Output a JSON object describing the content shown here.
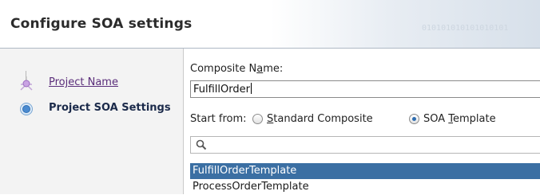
{
  "header": {
    "title": "Configure SOA settings",
    "binary": "010101010101010101"
  },
  "nav": {
    "items": [
      {
        "label": "Project Name",
        "state": "done",
        "icon": "completed-step-icon"
      },
      {
        "label": "Project SOA Settings",
        "state": "current",
        "icon": "current-step-icon"
      }
    ]
  },
  "form": {
    "composite_name": {
      "label_pre": "Composite N",
      "label_mnemonic": "a",
      "label_post": "me:",
      "value": "FulfillOrder"
    },
    "start_from": {
      "label": "Start from:",
      "options": [
        {
          "pre": "",
          "mnemonic": "S",
          "post": "tandard Composite",
          "selected": false
        },
        {
          "pre": "SOA ",
          "mnemonic": "T",
          "post": "emplate",
          "selected": true
        }
      ]
    },
    "search": {
      "value": ""
    },
    "templates": [
      "FulfillOrderTemplate",
      "ProcessOrderTemplate"
    ],
    "selected_template": "FulfillOrderTemplate"
  },
  "colors": {
    "selection": "#3b6fa3",
    "link": "#5a2d7a",
    "radio_dot": "#2e6db0"
  }
}
